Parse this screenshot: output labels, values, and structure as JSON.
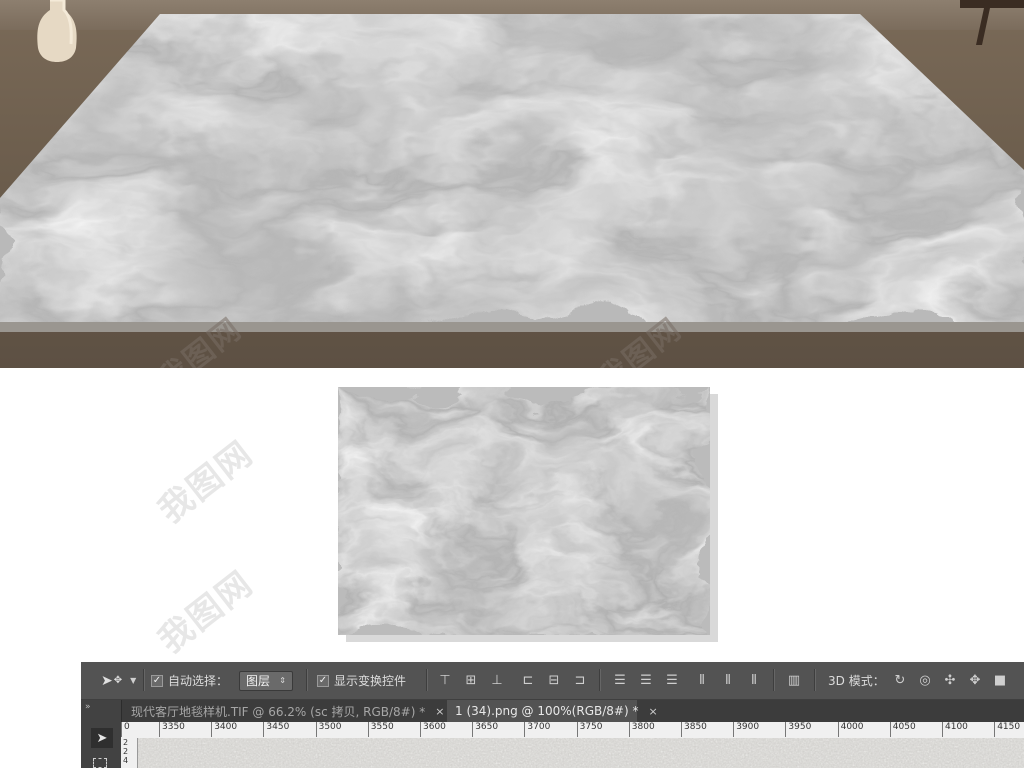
{
  "scene": {
    "watermark_text": "我图网"
  },
  "toolbar": {
    "move_tool_icon": "move-arrow-icon",
    "auto_select_label": "自动选择：",
    "auto_select_checked": true,
    "layer_select_value": "图层",
    "show_transform_label": "显示变换控件",
    "show_transform_checked": true,
    "mode_3d_label": "3D 模式："
  },
  "tabs": [
    {
      "label": "现代客厅地毯样机.TIF @ 66.2% (sc 拷贝, RGB/8#) *",
      "active": false,
      "close": "×"
    },
    {
      "label": "1 (34).png @ 100%(RGB/8#) *",
      "active": true,
      "close": "×"
    }
  ],
  "ruler": {
    "ticks": [
      "0",
      "3350",
      "3400",
      "3450",
      "3500",
      "3550",
      "3600",
      "3650",
      "3700",
      "3750",
      "3800",
      "3850",
      "3900",
      "3950",
      "4000",
      "4050",
      "4100",
      "4150"
    ],
    "vertical": [
      "2",
      "2",
      "4"
    ]
  },
  "colors": {
    "ps_panel": "#535353",
    "ps_tab_bar": "#3c3c3c",
    "floor": "#6e5f4e"
  }
}
